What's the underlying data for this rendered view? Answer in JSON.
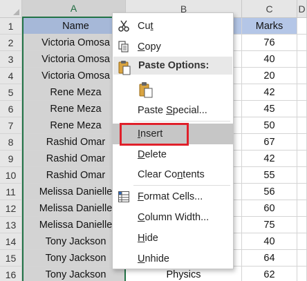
{
  "columns": [
    "A",
    "B",
    "C",
    "D"
  ],
  "rows": [
    {
      "n": "1",
      "a": "Name",
      "b": "",
      "c": "Marks"
    },
    {
      "n": "2",
      "a": "Victoria Omosa",
      "b": "",
      "c": "76"
    },
    {
      "n": "3",
      "a": "Victoria Omosa",
      "b": "",
      "c": "40"
    },
    {
      "n": "4",
      "a": "Victoria Omosa",
      "b": "",
      "c": "20"
    },
    {
      "n": "5",
      "a": "Rene Meza",
      "b": "",
      "c": "42"
    },
    {
      "n": "6",
      "a": "Rene Meza",
      "b": "",
      "c": "45"
    },
    {
      "n": "7",
      "a": "Rene Meza",
      "b": "",
      "c": "50"
    },
    {
      "n": "8",
      "a": "Rashid Omar",
      "b": "",
      "c": "67"
    },
    {
      "n": "9",
      "a": "Rashid Omar",
      "b": "",
      "c": "42"
    },
    {
      "n": "10",
      "a": "Rashid Omar",
      "b": "",
      "c": "55"
    },
    {
      "n": "11",
      "a": "Melissa Danielle",
      "b": "",
      "c": "56"
    },
    {
      "n": "12",
      "a": "Melissa Danielle",
      "b": "",
      "c": "60"
    },
    {
      "n": "13",
      "a": "Melissa Danielle",
      "b": "",
      "c": "75"
    },
    {
      "n": "14",
      "a": "Tony Jackson",
      "b": "",
      "c": "40"
    },
    {
      "n": "15",
      "a": "Tony Jackson",
      "b": "",
      "c": "64"
    },
    {
      "n": "16",
      "a": "Tony Jackson",
      "b": "Physics",
      "c": "62"
    }
  ],
  "menu": {
    "cut": {
      "pre": "Cu",
      "ul": "t",
      "post": ""
    },
    "copy": {
      "pre": "",
      "ul": "C",
      "post": "opy"
    },
    "paste_header": "Paste Options:",
    "paste_special": {
      "pre": "Paste ",
      "ul": "S",
      "post": "pecial..."
    },
    "insert": {
      "pre": "",
      "ul": "I",
      "post": "nsert"
    },
    "delete": {
      "pre": "",
      "ul": "D",
      "post": "elete"
    },
    "clear": {
      "pre": "Clear Co",
      "ul": "n",
      "post": "tents"
    },
    "format": {
      "pre": "",
      "ul": "F",
      "post": "ormat Cells..."
    },
    "colwidth": {
      "pre": "",
      "ul": "C",
      "post": "olumn Width..."
    },
    "hide": {
      "pre": "",
      "ul": "H",
      "post": "ide"
    },
    "unhide": {
      "pre": "",
      "ul": "U",
      "post": "nhide"
    }
  },
  "icons": {
    "cut": "scissors-icon",
    "copy": "copy-icon",
    "paste_header": "clipboard-icon",
    "paste_option": "paste-icon",
    "format": "format-cells-icon"
  },
  "colors": {
    "highlight_box": "#e0202a",
    "selected_column": "#217346",
    "header_fill": "#b4c6e7"
  }
}
